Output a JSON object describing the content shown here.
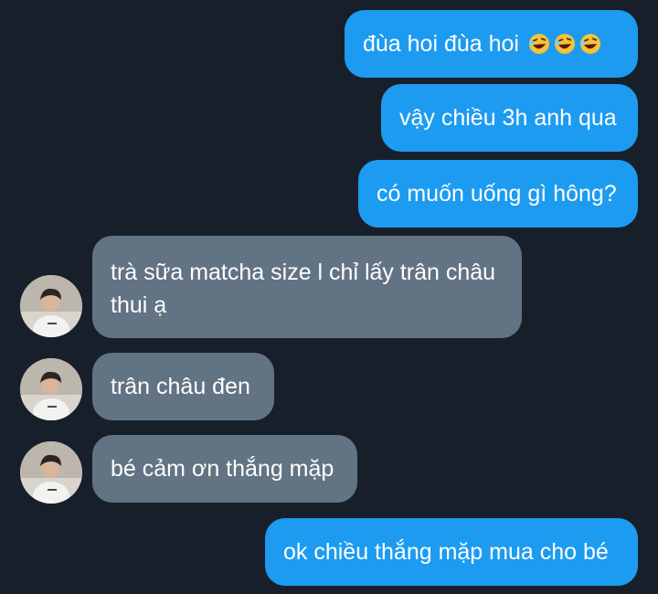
{
  "messages": [
    {
      "text": "đùa hoi đùa hoi",
      "emoji": "rolling-on-floor-laughing-icon",
      "emoji_count": 3
    },
    {
      "text": "vậy chiều 3h anh qua"
    },
    {
      "text": "có muốn uống gì hông?"
    },
    {
      "text_line1": "trà sữa matcha size l chỉ lấy trân châu",
      "text_line2": "thui ạ"
    },
    {
      "text": "trân châu đen"
    },
    {
      "text": "bé cảm ơn thắng mặp"
    },
    {
      "text": "ok chiều thắng mặp mua cho bé"
    }
  ],
  "colors": {
    "background": "#17202a",
    "outgoing_bubble": "#1d9bf0",
    "incoming_bubble": "#627384",
    "text": "#ffffff"
  }
}
